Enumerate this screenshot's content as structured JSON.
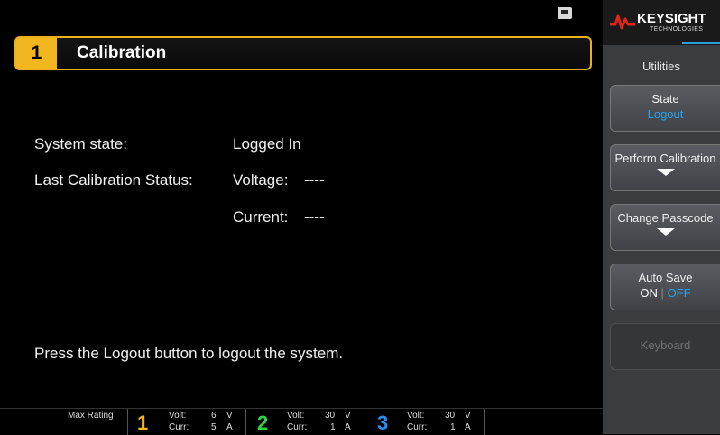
{
  "header": {
    "channel_number": "1",
    "title": "Calibration"
  },
  "icons": {
    "lan": "lan-icon",
    "logo": "keysight-logo-icon",
    "arrow": "arrow-down-icon"
  },
  "content": {
    "system_state_label": "System state:",
    "system_state_value": "Logged In",
    "last_cal_label": "Last Calibration Status:",
    "voltage_label": "Voltage:",
    "voltage_value": "----",
    "current_label": "Current:",
    "current_value": "----",
    "hint": "Press the Logout button to logout the system."
  },
  "status_bar": {
    "max_rating_label": "Max Rating",
    "channels": [
      {
        "num": "1",
        "color": "#f2b71e",
        "volt_label": "Volt:",
        "volt": "6",
        "volt_unit": "V",
        "curr_label": "Curr:",
        "curr": "5",
        "curr_unit": "A"
      },
      {
        "num": "2",
        "color": "#27d640",
        "volt_label": "Volt:",
        "volt": "30",
        "volt_unit": "V",
        "curr_label": "Curr:",
        "curr": "1",
        "curr_unit": "A"
      },
      {
        "num": "3",
        "color": "#2a8bf0",
        "volt_label": "Volt:",
        "volt": "30",
        "volt_unit": "V",
        "curr_label": "Curr:",
        "curr": "1",
        "curr_unit": "A"
      }
    ]
  },
  "panel": {
    "brand": "KEYSIGHT",
    "brand_sub": "TECHNOLOGIES",
    "menu_title": "Utilities",
    "softkeys": {
      "state": {
        "label": "State",
        "value": "Logout"
      },
      "perform_calibration": {
        "label": "Perform Calibration"
      },
      "change_passcode": {
        "label": "Change Passcode"
      },
      "auto_save": {
        "label": "Auto Save",
        "on": "ON",
        "sep": "|",
        "off": "OFF"
      },
      "keyboard": {
        "label": "Keyboard"
      }
    }
  },
  "colors": {
    "accent_yellow": "#f2b71e",
    "accent_blue": "#2aa3ee",
    "panel_bg": "#3a3d40",
    "brand_red": "#e2231a"
  }
}
